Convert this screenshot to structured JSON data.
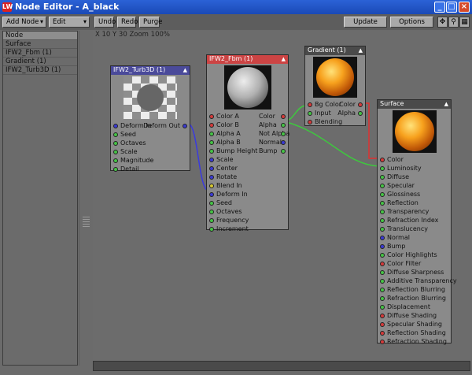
{
  "window": {
    "title": "Node Editor - A_black",
    "logo": "LW"
  },
  "toolbar": {
    "add_node": "Add Node",
    "edit": "Edit",
    "undo": "Undo",
    "redo": "Redo",
    "purge": "Purge",
    "update": "Update",
    "options": "Options"
  },
  "node_list": [
    "Node",
    "Surface",
    "IFW2_Fbm (1)",
    "Gradient (1)",
    "IFW2_Turb3D (1)"
  ],
  "canvas": {
    "coords": "X 10 Y 30 Zoom 100%"
  },
  "nodes": {
    "turb": {
      "title": "IFW2_Turb3D (1)",
      "output": "Deform Out",
      "inputs": [
        "Deform In",
        "Seed",
        "Octaves",
        "Scale",
        "Magnitude",
        "Detail"
      ]
    },
    "fbm": {
      "title": "IFW2_Fbm (1)",
      "inputs": [
        "Color A",
        "Color B",
        "Alpha A",
        "Alpha B",
        "Bump Height",
        "Scale",
        "Center",
        "Rotate",
        "Blend In",
        "Deform In",
        "Seed",
        "Octaves",
        "Frequency",
        "Increment"
      ],
      "outputs": [
        "Color",
        "Alpha",
        "Not Alpha",
        "Normal",
        "Bump"
      ]
    },
    "grad": {
      "title": "Gradient (1)",
      "inputs": [
        "Bg Color",
        "Input",
        "Blending"
      ],
      "outputs": [
        "Color",
        "Alpha"
      ]
    },
    "surf": {
      "title": "Surface",
      "inputs": [
        "Color",
        "Luminosity",
        "Diffuse",
        "Specular",
        "Glossiness",
        "Reflection",
        "Transparency",
        "Refraction Index",
        "Translucency",
        "Normal",
        "Bump",
        "Color Highlights",
        "Color Filter",
        "Diffuse Sharpness",
        "Additive Transparency",
        "Reflection Blurring",
        "Refraction Blurring",
        "Displacement",
        "Diffuse Shading",
        "Specular Shading",
        "Reflection Shading",
        "Refraction Shading"
      ]
    }
  },
  "colors": {
    "port_color": "#d33b3b",
    "port_scalar": "#46c246",
    "port_vector": "#3a3ad0",
    "port_deform": "#d6c833",
    "wire_red": "#e03030",
    "wire_green": "#3ec83e",
    "wire_blue": "#3a3ae0"
  }
}
